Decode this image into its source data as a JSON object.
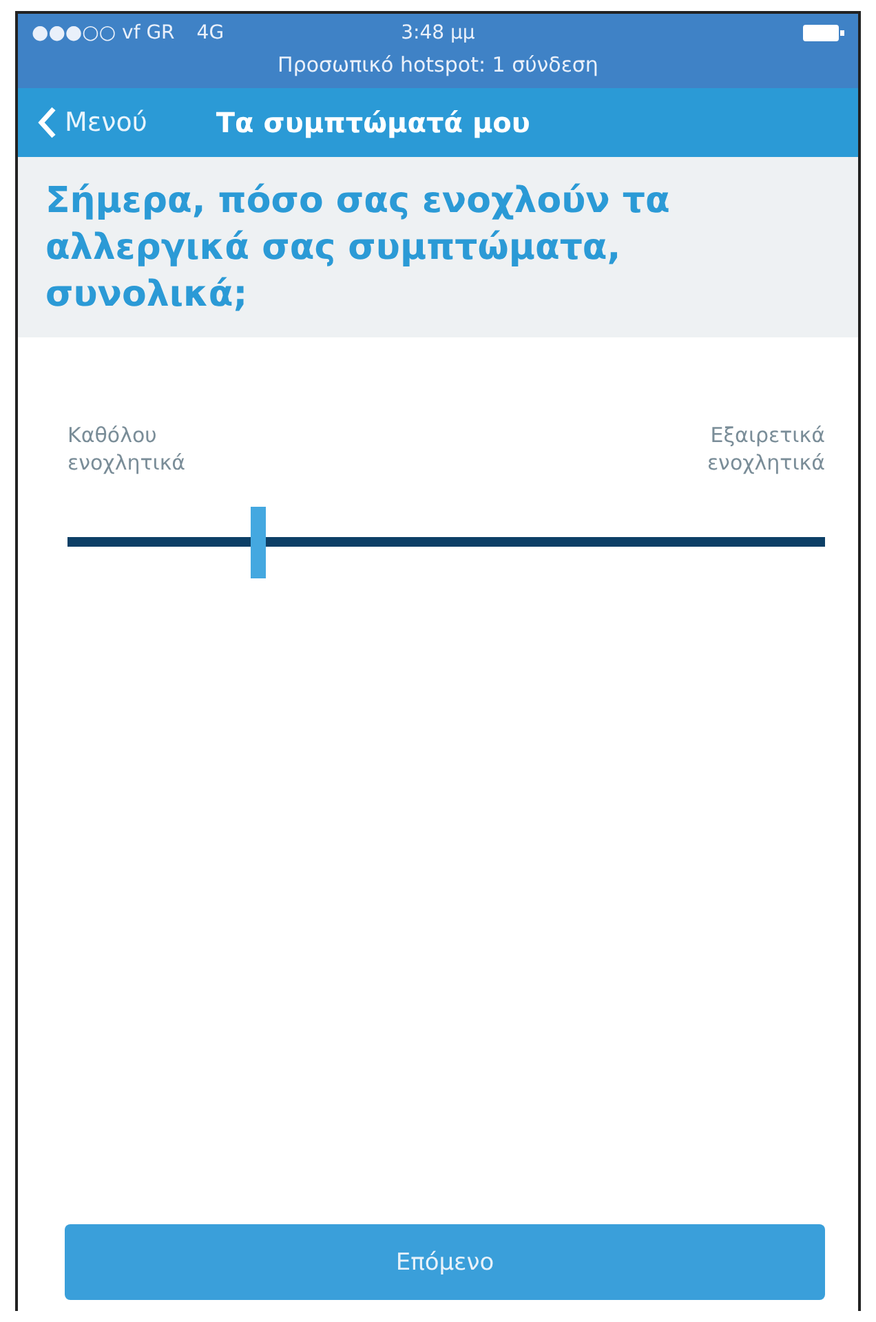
{
  "status_bar": {
    "carrier": "●●●○○ vf GR",
    "network": "4G",
    "time": "3:48 μμ",
    "hotspot": "Προσωπικό hotspot: 1 σύνδεση"
  },
  "nav": {
    "back": "Μενού",
    "title": "Τα συμπτώματά μου"
  },
  "question": "Σήμερα, πόσο σας ενοχλούν τα αλλεργικά σας συμπτώματα, συνολικά;",
  "slider": {
    "min_label": "Καθόλου ενοχλητικά",
    "max_label": "Εξαιρετικά ενοχλητικά",
    "level": 0.25
  },
  "next_button": "Επόμενο"
}
